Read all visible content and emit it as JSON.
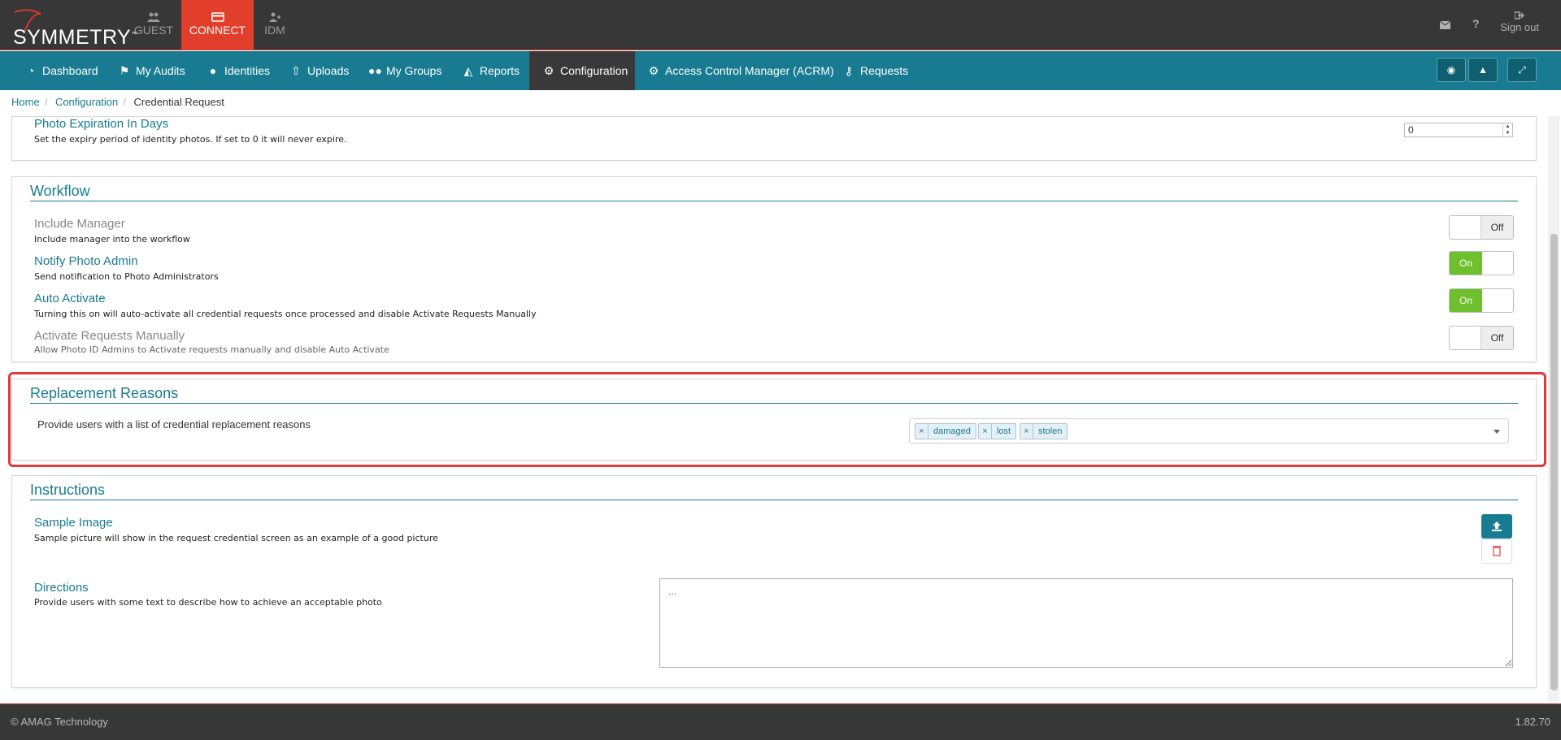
{
  "brand": {
    "name": "SYMMETRY",
    "tm": "™"
  },
  "apps": [
    {
      "label": "GUEST",
      "icon": "guest-users-icon",
      "active": false
    },
    {
      "label": "CONNECT",
      "icon": "credit-card-icon",
      "active": true
    },
    {
      "label": "IDM",
      "icon": "user-plus-icon",
      "active": false
    }
  ],
  "topRight": {
    "mail": "envelope-icon",
    "help": "?",
    "signout": "Sign out"
  },
  "nav": [
    {
      "label": "Dashboard",
      "icon": "dashboard-icon"
    },
    {
      "label": "My Audits",
      "icon": "flag-icon"
    },
    {
      "label": "Identities",
      "icon": "user-icon"
    },
    {
      "label": "Uploads",
      "icon": "upload-icon"
    },
    {
      "label": "My Groups",
      "icon": "group-icon"
    },
    {
      "label": "Reports",
      "icon": "area-chart-icon"
    },
    {
      "label": "Configuration",
      "icon": "gear-icon",
      "active": true
    },
    {
      "label": "Access Control Manager (ACRM)",
      "icon": "gear-icon"
    },
    {
      "label": "Requests",
      "icon": "key-icon"
    }
  ],
  "breadcrumb": [
    "Home",
    "Configuration",
    "Credential Request"
  ],
  "photo": {
    "title": "Photo Expiration In Days",
    "desc": "Set the expiry period of identity photos. If set to 0 it will never expire.",
    "value": "0"
  },
  "workflow": {
    "title": "Workflow",
    "items": [
      {
        "title": "Include Manager",
        "desc": "Include manager into the workflow",
        "state": "Off"
      },
      {
        "title": "Notify Photo Admin",
        "desc": "Send notification to Photo Administrators",
        "state": "On"
      },
      {
        "title": "Auto Activate",
        "desc": "Turning this on will auto-activate all credential requests once processed and disable Activate Requests Manually",
        "state": "On"
      },
      {
        "title": "Activate Requests Manually",
        "desc": "Allow Photo ID Admins to Activate requests manually and disable Auto Activate",
        "state": "Off"
      }
    ]
  },
  "replacement": {
    "title": "Replacement Reasons",
    "desc": "Provide users with a list of credential replacement reasons",
    "tags": [
      "damaged",
      "lost",
      "stolen"
    ],
    "remove": "×"
  },
  "instructions": {
    "title": "Instructions",
    "sample": {
      "title": "Sample Image",
      "desc": "Sample picture will show in the request credential screen as an example of a good picture"
    },
    "directions": {
      "title": "Directions",
      "desc": "Provide users with some text to describe how to achieve an acceptable photo",
      "placeholder": "..."
    }
  },
  "footer": {
    "copyright": "© AMAG Technology",
    "version": "1.82.70"
  },
  "colors": {
    "teal": "#187b91",
    "red": "#e13e2b",
    "dark": "#373737",
    "green": "#6ec02e"
  }
}
